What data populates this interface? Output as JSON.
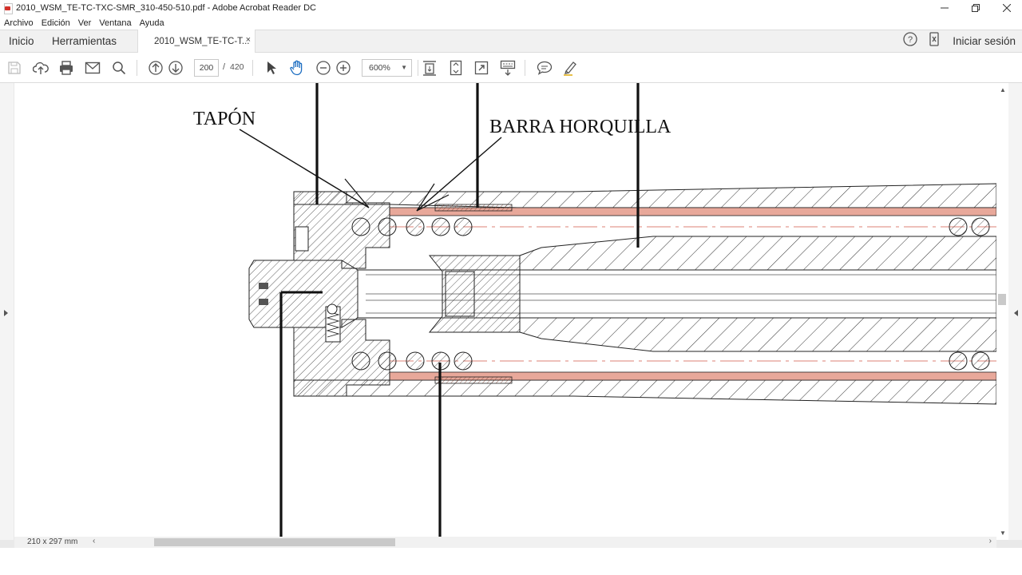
{
  "window": {
    "title": "2010_WSM_TE-TC-TXC-SMR_310-450-510.pdf - Adobe Acrobat Reader DC",
    "minimize_icon": "minimize-icon",
    "maximize_icon": "restore-icon",
    "close_icon": "close-icon"
  },
  "menu": {
    "items": [
      "Archivo",
      "Edición",
      "Ver",
      "Ventana",
      "Ayuda"
    ]
  },
  "tabs": {
    "home": "Inicio",
    "tools": "Herramientas",
    "document": "2010_WSM_TE-TC-T...",
    "close_symbol": "×",
    "sign_in": "Iniciar sesión"
  },
  "toolbar": {
    "page_current": "200",
    "page_separator": "/",
    "page_total": "420",
    "zoom": "600%"
  },
  "document": {
    "label_tapon": "TAPÓN",
    "label_barra": "BARRA HORQUILLA",
    "page_size": "210 x 297 mm",
    "accent_copper": "#e8a89a"
  }
}
